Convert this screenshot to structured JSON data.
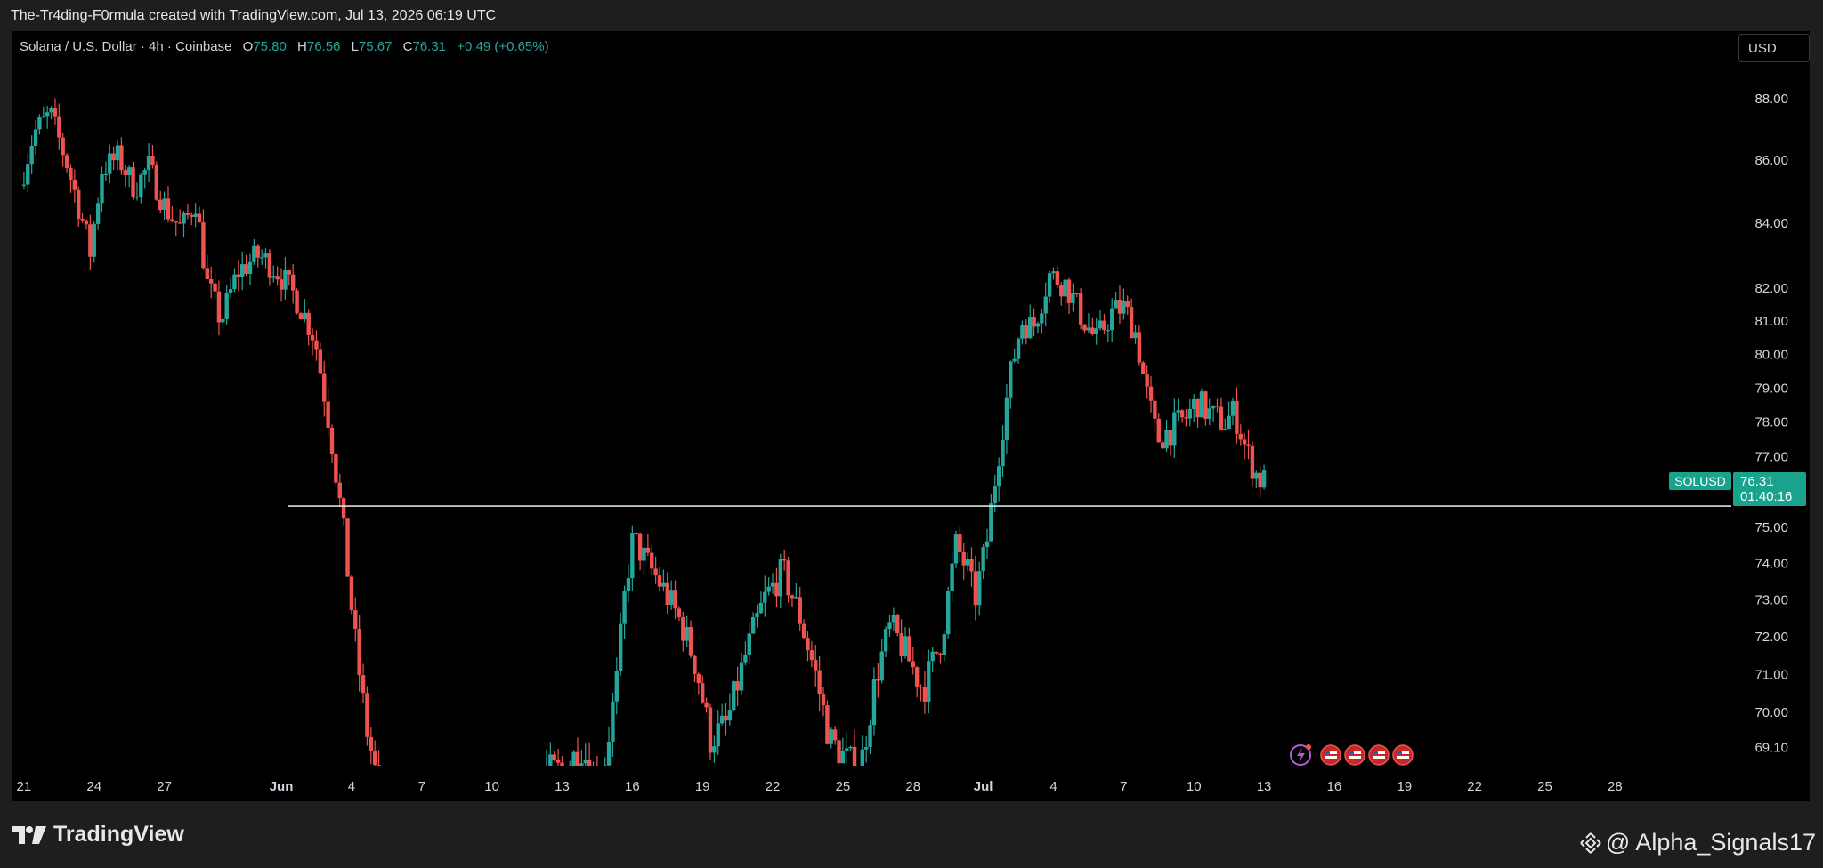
{
  "attribution": "The-Tr4ding-F0rmula created with TradingView.com, Jul 13, 2026 06:19 UTC",
  "legend": {
    "symbol": "Solana / U.S. Dollar · 4h · Coinbase",
    "open_label": "O",
    "open": "75.80",
    "high_label": "H",
    "high": "76.56",
    "low_label": "L",
    "low": "75.67",
    "close_label": "C",
    "close": "76.31",
    "change": "+0.49 (+0.65%)"
  },
  "currency_button": "USD",
  "price_badge": {
    "symbol": "SOLUSD",
    "price": "76.31",
    "countdown": "01:40:16"
  },
  "footer": {
    "brand": "TradingView",
    "handle": "@ Alpha_Signals17"
  },
  "colors": {
    "up": "#26a69a",
    "down": "#ef5350",
    "background": "#000000",
    "text": "#d1d4dc"
  },
  "chart_data": {
    "type": "candlestick",
    "y_scale": "log",
    "ylim": [
      68.4,
      90.0
    ],
    "y_ticks": [
      "88.00",
      "86.00",
      "84.00",
      "82.00",
      "81.00",
      "80.00",
      "79.00",
      "78.00",
      "77.00",
      "75.00",
      "74.00",
      "73.00",
      "72.00",
      "71.00",
      "70.00",
      "69.10"
    ],
    "x_ticks": [
      {
        "label": "21",
        "day": 0
      },
      {
        "label": "24",
        "day": 3
      },
      {
        "label": "27",
        "day": 6
      },
      {
        "label": "Jun",
        "day": 11
      },
      {
        "label": "4",
        "day": 14
      },
      {
        "label": "7",
        "day": 17
      },
      {
        "label": "10",
        "day": 20
      },
      {
        "label": "13",
        "day": 23
      },
      {
        "label": "16",
        "day": 26
      },
      {
        "label": "19",
        "day": 29
      },
      {
        "label": "22",
        "day": 32
      },
      {
        "label": "25",
        "day": 35
      },
      {
        "label": "28",
        "day": 38
      },
      {
        "label": "Jul",
        "day": 41
      },
      {
        "label": "4",
        "day": 44
      },
      {
        "label": "7",
        "day": 47
      },
      {
        "label": "10",
        "day": 50
      },
      {
        "label": "13",
        "day": 53
      },
      {
        "label": "16",
        "day": 56
      },
      {
        "label": "19",
        "day": 59
      },
      {
        "label": "22",
        "day": 62
      },
      {
        "label": "25",
        "day": 65
      },
      {
        "label": "28",
        "day": 68
      }
    ],
    "x_range_days": [
      -0.3,
      71.6
    ],
    "horizontal_line": {
      "price": 75.6,
      "from_day": 11.3
    },
    "price_path": [
      [
        0,
        85.2
      ],
      [
        0.6,
        86.9
      ],
      [
        1.3,
        87.5
      ],
      [
        2.0,
        85.9
      ],
      [
        2.7,
        84.0
      ],
      [
        3.0,
        83.1
      ],
      [
        3.5,
        85.7
      ],
      [
        4.2,
        86.1
      ],
      [
        4.9,
        85.1
      ],
      [
        5.5,
        85.8
      ],
      [
        6.2,
        84.5
      ],
      [
        6.9,
        83.8
      ],
      [
        7.5,
        84.7
      ],
      [
        8.0,
        82.1
      ],
      [
        8.6,
        81.0
      ],
      [
        9.3,
        82.5
      ],
      [
        10.2,
        83.0
      ],
      [
        10.9,
        82.6
      ],
      [
        11.8,
        81.7
      ],
      [
        12.6,
        80.5
      ],
      [
        13.3,
        77.6
      ],
      [
        13.8,
        75.0
      ],
      [
        14.3,
        72.0
      ],
      [
        14.8,
        69.6
      ],
      [
        15.2,
        68.4
      ],
      [
        15.3,
        66.0
      ],
      [
        22.3,
        66.0
      ],
      [
        22.5,
        68.5
      ],
      [
        23.2,
        68.5
      ],
      [
        24.0,
        69.1
      ],
      [
        24.8,
        68.0
      ],
      [
        25.5,
        70.8
      ],
      [
        25.9,
        73.5
      ],
      [
        26.2,
        74.7
      ],
      [
        26.8,
        74.0
      ],
      [
        27.5,
        73.3
      ],
      [
        28.3,
        72.3
      ],
      [
        28.9,
        71.2
      ],
      [
        29.5,
        69.3
      ],
      [
        30.2,
        69.7
      ],
      [
        31.0,
        71.5
      ],
      [
        31.8,
        73.0
      ],
      [
        32.6,
        73.8
      ],
      [
        33.3,
        72.6
      ],
      [
        34.0,
        71.0
      ],
      [
        34.6,
        69.3
      ],
      [
        35.3,
        68.8
      ],
      [
        35.9,
        68.5
      ],
      [
        36.6,
        71.0
      ],
      [
        37.2,
        72.3
      ],
      [
        37.9,
        71.5
      ],
      [
        38.6,
        70.6
      ],
      [
        39.4,
        72.0
      ],
      [
        40.0,
        74.5
      ],
      [
        40.5,
        73.8
      ],
      [
        40.8,
        73.0
      ],
      [
        41.3,
        74.5
      ],
      [
        41.8,
        77.0
      ],
      [
        42.3,
        79.3
      ],
      [
        42.8,
        81.0
      ],
      [
        43.3,
        80.8
      ],
      [
        44.0,
        82.4
      ],
      [
        44.7,
        82.1
      ],
      [
        45.4,
        81.1
      ],
      [
        46.0,
        80.4
      ],
      [
        46.7,
        81.3
      ],
      [
        47.2,
        81.4
      ],
      [
        47.7,
        80.6
      ],
      [
        48.1,
        79.0
      ],
      [
        48.6,
        77.5
      ],
      [
        49.2,
        77.8
      ],
      [
        49.8,
        78.1
      ],
      [
        50.3,
        78.6
      ],
      [
        50.9,
        78.2
      ],
      [
        51.5,
        78.0
      ],
      [
        51.9,
        78.3
      ],
      [
        52.4,
        77.2
      ],
      [
        52.9,
        76.4
      ],
      [
        53.1,
        76.31
      ]
    ]
  }
}
